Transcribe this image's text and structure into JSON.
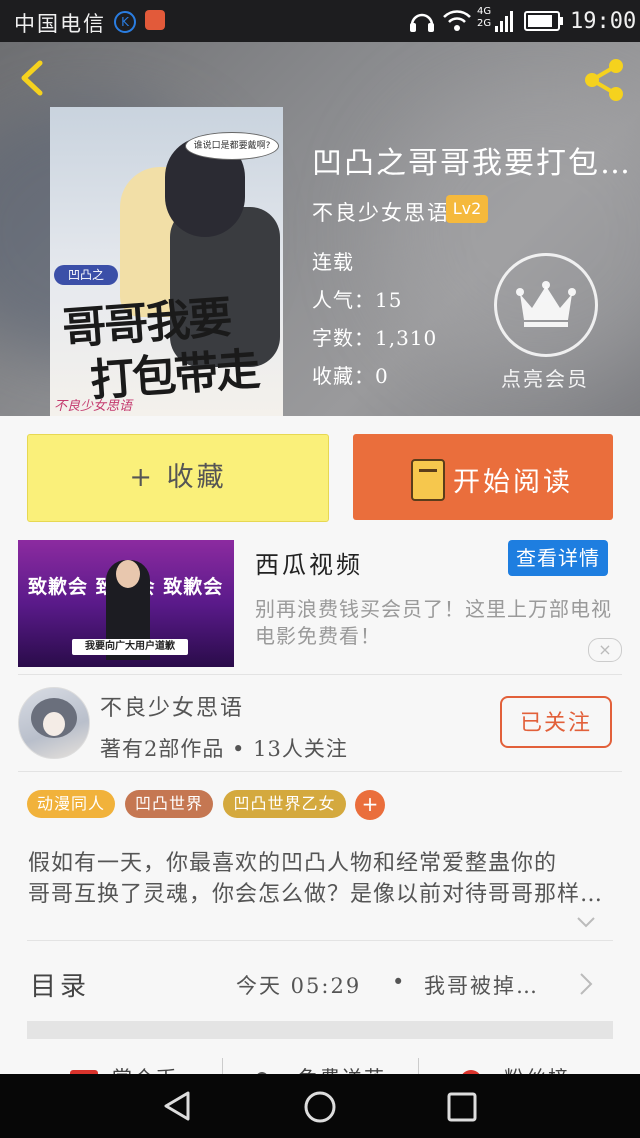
{
  "status_bar": {
    "carrier": "中国电信",
    "time": "19:00",
    "network": "4G 2G"
  },
  "book": {
    "title": "凹凸之哥哥我要打包带走",
    "author": "不良少女思语",
    "author_level": "Lv2",
    "status": "连载",
    "popularity": "人气：15",
    "word_count": "字数：1,310",
    "favorites": "收藏：0",
    "vip_label": "点亮会员",
    "cover": {
      "bubble": "谁说口是都要戴啊?",
      "tag": "凹凸之",
      "title_line1": "哥哥我要",
      "title_line2": "打包带走",
      "signature": "不良少女思语"
    }
  },
  "actions": {
    "favorite_label": "+ 收藏",
    "read_label": "开始阅读"
  },
  "ad": {
    "image_banner": "致歉会 致歉会 致歉会",
    "image_caption": "我要向广大用户道歉",
    "title": "西瓜视频",
    "button": "查看详情",
    "description": "别再浪费钱买会员了！这里上万部电视电影免费看！",
    "close": "×"
  },
  "author_card": {
    "name": "不良少女思语",
    "stats": "著有2部作品 • 13人关注",
    "follow_label": "已关注"
  },
  "tags": [
    {
      "label": "动漫同人",
      "color": "#f1b23b"
    },
    {
      "label": "凹凸世界",
      "color": "#c57752"
    },
    {
      "label": "凹凸世界乙女",
      "color": "#d4a93e"
    }
  ],
  "tag_add": "+",
  "synopsis": {
    "line1": "假如有一天，你最喜欢的凹凸人物和经常爱整蛊你的",
    "line2": "哥哥互换了灵魂，你会怎么做？是像以前对待哥哥那样对待他"
  },
  "toc": {
    "label": "目录",
    "date": "今天 05:29",
    "separator": "•",
    "latest_chapter": "我哥被掉包了"
  },
  "bottom_tabs": [
    "赏个币",
    "免费送花",
    "粉丝榜"
  ],
  "colors": {
    "accent": "#ea6e3c",
    "favorite_bg": "#faf07a",
    "link_blue": "#1e7ee0"
  }
}
